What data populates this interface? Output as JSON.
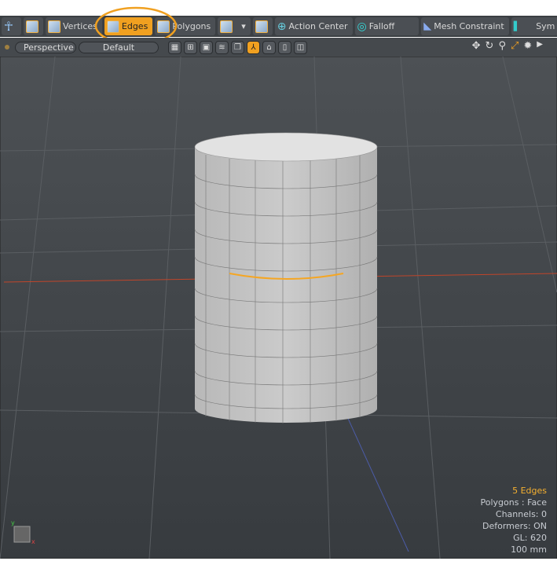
{
  "toolbar": {
    "vertices": "Vertices",
    "edges": "Edges",
    "polygons": "Polygons",
    "action_center": "Action Center",
    "falloff": "Falloff",
    "mesh_constraint": "Mesh Constraint",
    "symmetry": "Sym"
  },
  "viewport": {
    "view": "Perspective",
    "style": "Default"
  },
  "info": {
    "selection": "5 Edges",
    "polygons": "Polygons : Face",
    "channels": "Channels: 0",
    "deformers": "Deformers: ON",
    "gl": "GL: 620",
    "scale": "100 mm"
  },
  "colors": {
    "accent": "#f0a020",
    "selection": "#f5b030"
  }
}
